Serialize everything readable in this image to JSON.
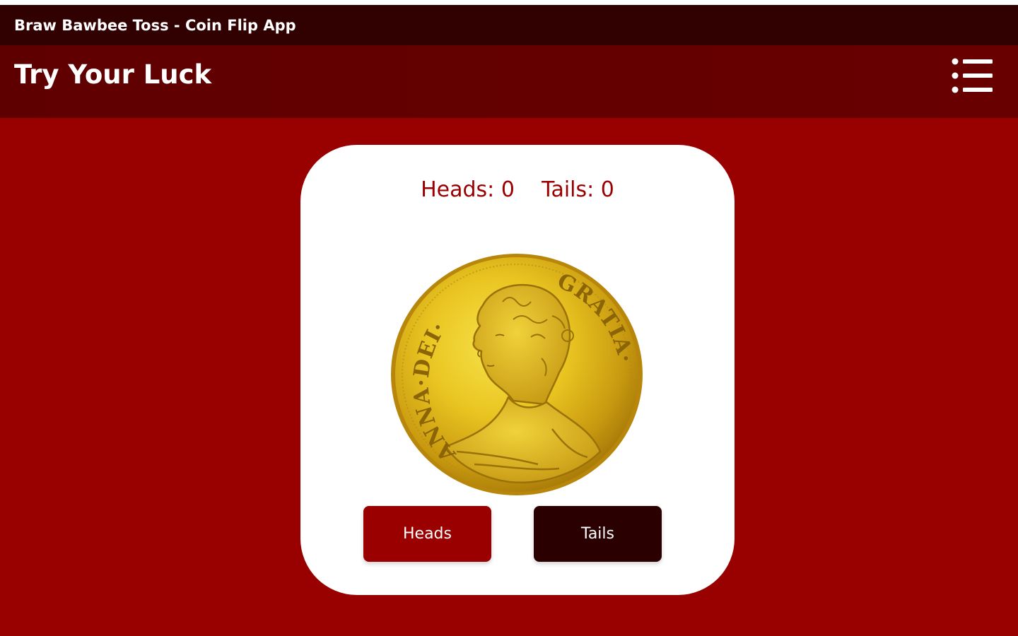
{
  "window": {
    "title": "Braw Bawbee Toss - Coin Flip App"
  },
  "header": {
    "title": "Try Your Luck",
    "menu_icon": "hamburger-menu-icon"
  },
  "score": {
    "heads_label": "Heads:",
    "heads_value": 0,
    "tails_label": "Tails:",
    "tails_value": 0
  },
  "coin": {
    "face": "heads",
    "inscription_left": "ANNA·DEI·",
    "inscription_right": "GRATIA·"
  },
  "buttons": {
    "heads_label": "Heads",
    "tails_label": "Tails"
  },
  "colors": {
    "titlebar": "#310000",
    "appbar": "#640000",
    "background": "#990000",
    "card": "#ffffff",
    "score_text": "#9b0000",
    "heads_button": "#9b0000",
    "tails_button": "#2a0000",
    "coin_gold": "#e0b81a"
  }
}
